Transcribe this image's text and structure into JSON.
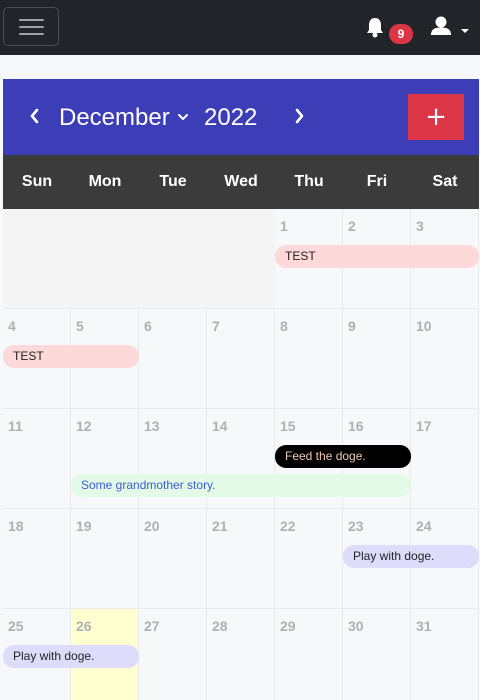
{
  "navbar": {
    "notification_count": "9"
  },
  "calendar": {
    "month": "December",
    "year": "2022",
    "add_label": "+",
    "weekdays": [
      "Sun",
      "Mon",
      "Tue",
      "Wed",
      "Thu",
      "Fri",
      "Sat"
    ],
    "days": [
      [
        "",
        "",
        "",
        "",
        "1",
        "2",
        "3"
      ],
      [
        "4",
        "5",
        "6",
        "7",
        "8",
        "9",
        "10"
      ],
      [
        "11",
        "12",
        "13",
        "14",
        "15",
        "16",
        "17"
      ],
      [
        "18",
        "19",
        "20",
        "21",
        "22",
        "23",
        "24"
      ],
      [
        "25",
        "26",
        "27",
        "28",
        "29",
        "30",
        "31"
      ]
    ],
    "events": [
      {
        "label": "TEST",
        "color": "#fdd9da"
      },
      {
        "label": "TEST",
        "color": "#fdd9da"
      },
      {
        "label": "Feed the doge.",
        "color": "#000000"
      },
      {
        "label": "Some grandmother story.",
        "color": "#e3fbe6"
      },
      {
        "label": "Play with doge.",
        "color": "#ddddfb"
      },
      {
        "label": "Play with doge.",
        "color": "#ddddfb"
      }
    ]
  },
  "colors": {
    "header_bg": "#3d3db8",
    "add_button": "#dc3545",
    "navbar_bg": "#212529",
    "today_highlight": "#fefed0"
  },
  "icons": [
    "menu-icon",
    "bell-icon",
    "user-icon",
    "caret-down-icon",
    "chevron-left-icon",
    "chevron-right-icon"
  ]
}
